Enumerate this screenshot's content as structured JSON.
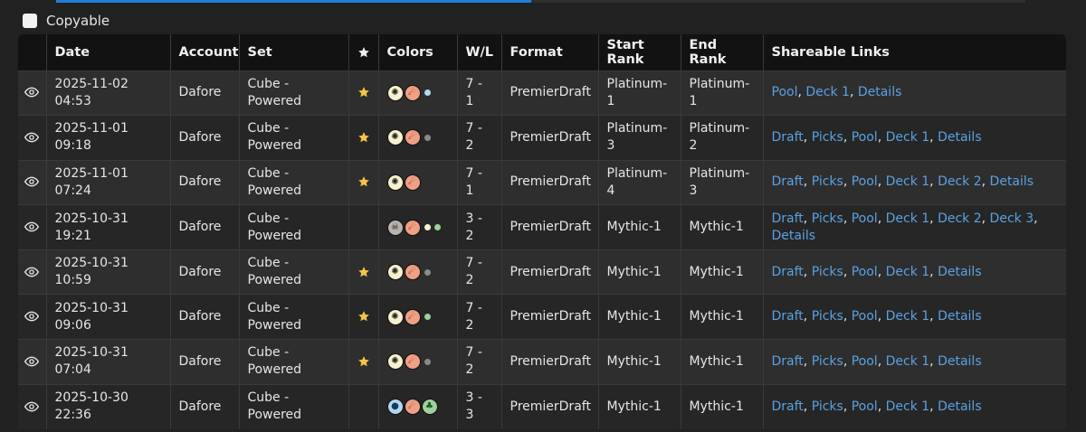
{
  "progress": {
    "fraction": 0.49
  },
  "copyable": {
    "label": "Copyable",
    "checked": false
  },
  "columns": [
    "Date",
    "Account",
    "Set",
    "",
    "Colors",
    "W/L",
    "Format",
    "Start Rank",
    "End Rank",
    "Shareable Links"
  ],
  "icons": {
    "view": "eye-icon",
    "favorite": "star-icon"
  },
  "colors_map": {
    "W": "#f6f1cf",
    "R": "#f0a085",
    "B": "#b9b3ad",
    "U": "#b4d7ef",
    "G": "#9fcf9f"
  },
  "rows": [
    {
      "date": "2025-11-02",
      "time": "04:53",
      "account": "Dafore",
      "set1": "Cube -",
      "set2": "Powered",
      "starred": true,
      "colors": [
        "W",
        "R"
      ],
      "pips": [
        "#b4d7ef"
      ],
      "wl": "7 - 1",
      "format": "PremierDraft",
      "start": "Platinum-1",
      "end": "Platinum-1",
      "links": [
        [
          "Pool",
          "Deck 1",
          "Details"
        ]
      ]
    },
    {
      "date": "2025-11-01",
      "time": "09:18",
      "account": "Dafore",
      "set1": "Cube -",
      "set2": "Powered",
      "starred": true,
      "colors": [
        "W",
        "R"
      ],
      "pips": [
        "#8a8a8a"
      ],
      "wl": "7 - 2",
      "format": "PremierDraft",
      "start": "Platinum-3",
      "end": "Platinum-2",
      "links": [
        [
          "Draft",
          "Picks",
          "Pool",
          "Deck 1",
          "Details"
        ]
      ]
    },
    {
      "date": "2025-11-01",
      "time": "07:24",
      "account": "Dafore",
      "set1": "Cube -",
      "set2": "Powered",
      "starred": true,
      "colors": [
        "W",
        "R"
      ],
      "pips": [],
      "wl": "7 - 1",
      "format": "PremierDraft",
      "start": "Platinum-4",
      "end": "Platinum-3",
      "links": [
        [
          "Draft",
          "Picks",
          "Pool",
          "Deck 1",
          "Deck 2",
          "Details"
        ]
      ]
    },
    {
      "date": "2025-10-31",
      "time": "19:21",
      "account": "Dafore",
      "set1": "Cube -",
      "set2": "Powered",
      "starred": false,
      "colors": [
        "B",
        "R"
      ],
      "pips": [
        "#f6f1cf",
        "#9fcf9f"
      ],
      "wl": "3 - 2",
      "format": "PremierDraft",
      "start": "Mythic-1",
      "end": "Mythic-1",
      "links": [
        [
          "Draft",
          "Picks",
          "Pool",
          "Deck 1",
          "Deck 2",
          "Deck 3"
        ],
        [
          "Details"
        ]
      ]
    },
    {
      "date": "2025-10-31",
      "time": "10:59",
      "account": "Dafore",
      "set1": "Cube -",
      "set2": "Powered",
      "starred": true,
      "colors": [
        "W",
        "R"
      ],
      "pips": [
        "#8a8a8a"
      ],
      "wl": "7 - 2",
      "format": "PremierDraft",
      "start": "Mythic-1",
      "end": "Mythic-1",
      "links": [
        [
          "Draft",
          "Picks",
          "Pool",
          "Deck 1",
          "Details"
        ]
      ]
    },
    {
      "date": "2025-10-31",
      "time": "09:06",
      "account": "Dafore",
      "set1": "Cube -",
      "set2": "Powered",
      "starred": true,
      "colors": [
        "W",
        "R"
      ],
      "pips": [
        "#9fcf9f"
      ],
      "wl": "7 - 2",
      "format": "PremierDraft",
      "start": "Mythic-1",
      "end": "Mythic-1",
      "links": [
        [
          "Draft",
          "Picks",
          "Pool",
          "Deck 1",
          "Details"
        ]
      ]
    },
    {
      "date": "2025-10-31",
      "time": "07:04",
      "account": "Dafore",
      "set1": "Cube -",
      "set2": "Powered",
      "starred": true,
      "colors": [
        "W",
        "R"
      ],
      "pips": [
        "#8a8a8a"
      ],
      "wl": "7 - 2",
      "format": "PremierDraft",
      "start": "Mythic-1",
      "end": "Mythic-1",
      "links": [
        [
          "Draft",
          "Picks",
          "Pool",
          "Deck 1",
          "Details"
        ]
      ]
    },
    {
      "date": "2025-10-30",
      "time": "22:36",
      "account": "Dafore",
      "set1": "Cube -",
      "set2": "Powered",
      "starred": false,
      "colors": [
        "U",
        "R",
        "G"
      ],
      "pips": [],
      "wl": "3 - 3",
      "format": "PremierDraft",
      "start": "Mythic-1",
      "end": "Mythic-1",
      "links": [
        [
          "Draft",
          "Picks",
          "Pool",
          "Deck 1",
          "Details"
        ]
      ]
    }
  ]
}
